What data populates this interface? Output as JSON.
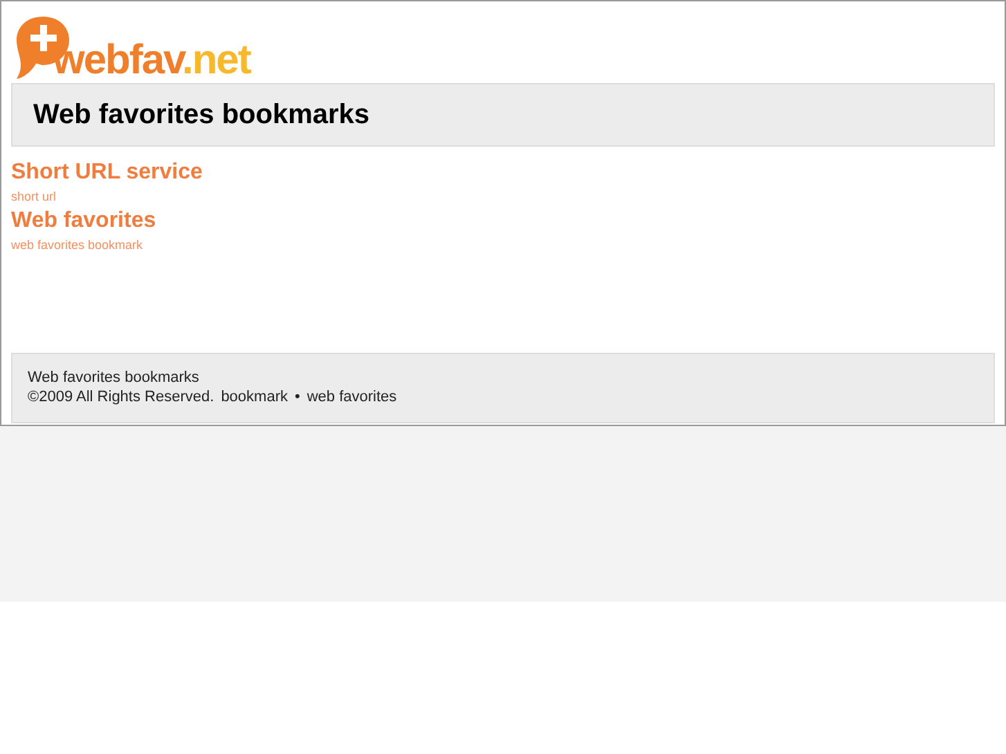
{
  "logo": {
    "name": "webfav",
    "suffix": ".net"
  },
  "header": {
    "title": "Web favorites bookmarks"
  },
  "links": [
    {
      "title": "Short URL service",
      "subtitle": "short url"
    },
    {
      "title": "Web favorites",
      "subtitle": "web favorites bookmark"
    }
  ],
  "footer": {
    "title": "Web favorites bookmarks",
    "copyright": "©2009 All Rights Reserved.",
    "links": [
      "bookmark",
      "web favorites"
    ],
    "separator": "•"
  }
}
